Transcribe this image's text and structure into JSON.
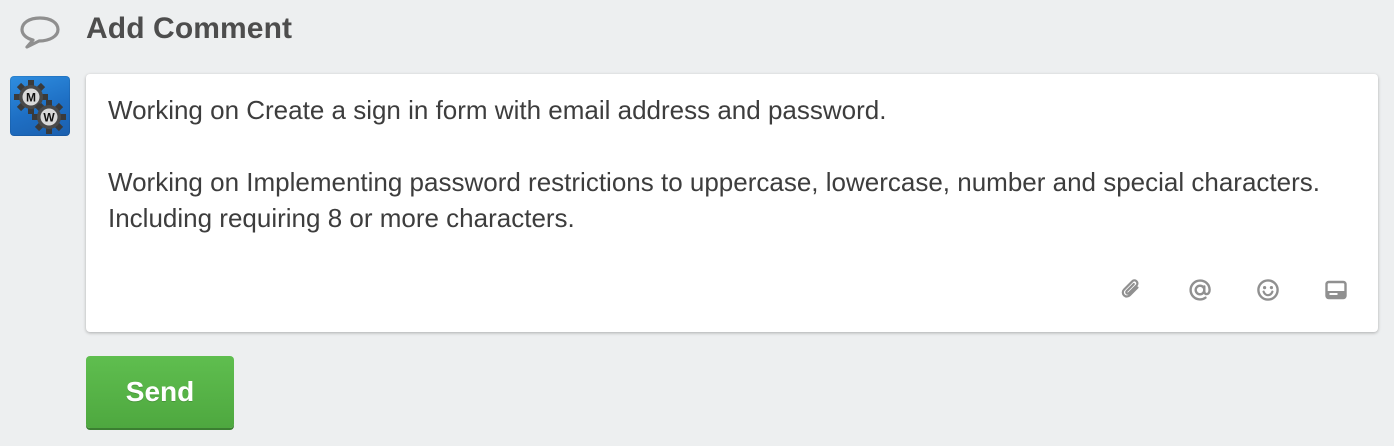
{
  "header": {
    "icon": "speech-bubble-icon",
    "title": "Add Comment"
  },
  "user": {
    "avatar_icon": "gears-avatar-icon",
    "initials_top": "M",
    "initials_bottom": "W"
  },
  "comment": {
    "paragraphs": [
      "Working on Create a sign in form with email address and password.",
      "Working on Implementing password restrictions to uppercase, lowercase, number and special characters. Including requiring 8 or more characters."
    ]
  },
  "tools": [
    {
      "name": "attach-icon"
    },
    {
      "name": "mention-icon"
    },
    {
      "name": "emoji-icon"
    },
    {
      "name": "card-icon"
    }
  ],
  "send_button": {
    "label": "Send",
    "color": "#5aaf4b"
  },
  "colors": {
    "background": "#edeff0",
    "icon_gray": "#909090",
    "avatar_blue": "#2576cf"
  }
}
